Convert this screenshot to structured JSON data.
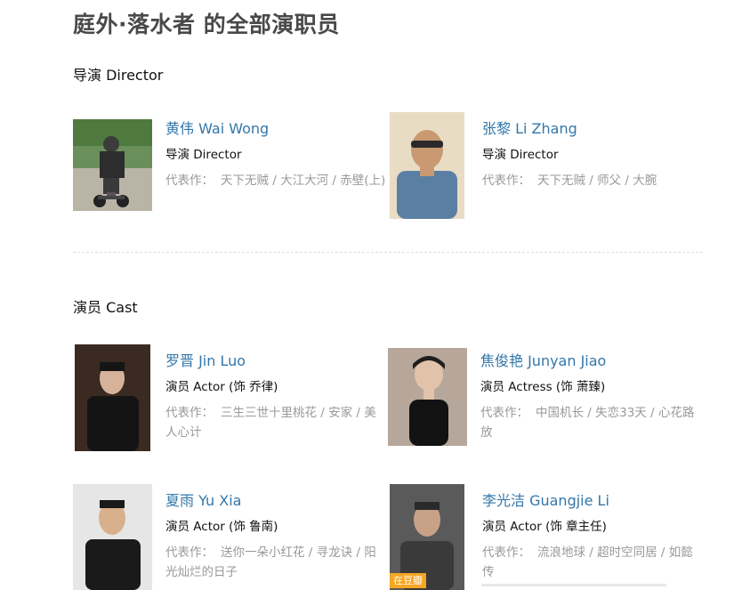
{
  "page": {
    "title": "庭外·落水者 的全部演职员"
  },
  "sections": {
    "directors_title": "导演 Director",
    "cast_title": "演员 Cast"
  },
  "works_label": "代表作：",
  "people": [
    {
      "name": "黄伟 Wai Wong",
      "role": "导演 Director",
      "works": "天下无贼 / 大江大河 / 赤壁(上)"
    },
    {
      "name": "张黎 Li Zhang",
      "role": "导演 Director",
      "works": "天下无贼 / 师父 / 大腕"
    },
    {
      "name": "罗晋 Jin Luo",
      "role": "演员 Actor (饰 乔律)",
      "works": "三生三世十里桃花 / 安家 / 美人心计"
    },
    {
      "name": "焦俊艳 Junyan Jiao",
      "role": "演员 Actress (饰 萧臻)",
      "works": "中国机长 / 失恋33天 / 心花路放"
    },
    {
      "name": "夏雨 Yu Xia",
      "role": "演员 Actor (饰 鲁南)",
      "works": "送你一朵小红花 / 寻龙诀 / 阳光灿烂的日子"
    },
    {
      "name": "李光洁 Guangjie Li",
      "role": "演员 Actor (饰 章主任)",
      "works": "流浪地球 / 超时空同居 / 如懿传",
      "badge": "在豆瓣"
    }
  ],
  "colors": {
    "link": "#3377aa",
    "muted": "#999999",
    "badge": "#f5a623"
  }
}
